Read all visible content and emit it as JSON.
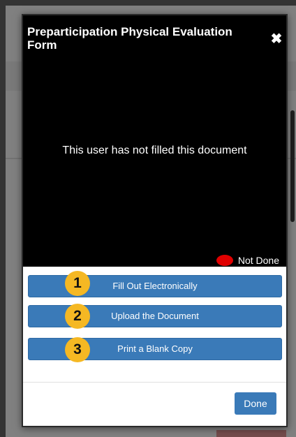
{
  "modal": {
    "title": "Preparticipation Physical Evaluation Form",
    "close_symbol": "✖",
    "message": "This user has not filled this document",
    "status": {
      "label": "Not Done",
      "color": "#e00000"
    }
  },
  "actions": [
    {
      "step": "1",
      "label": "Fill Out Electronically"
    },
    {
      "step": "2",
      "label": "Upload the Document"
    },
    {
      "step": "3",
      "label": "Print a Blank Copy"
    }
  ],
  "footer": {
    "done_label": "Done"
  },
  "colors": {
    "button": "#3a7ab8",
    "badge": "#f5b823",
    "status_dot": "#e00000"
  }
}
